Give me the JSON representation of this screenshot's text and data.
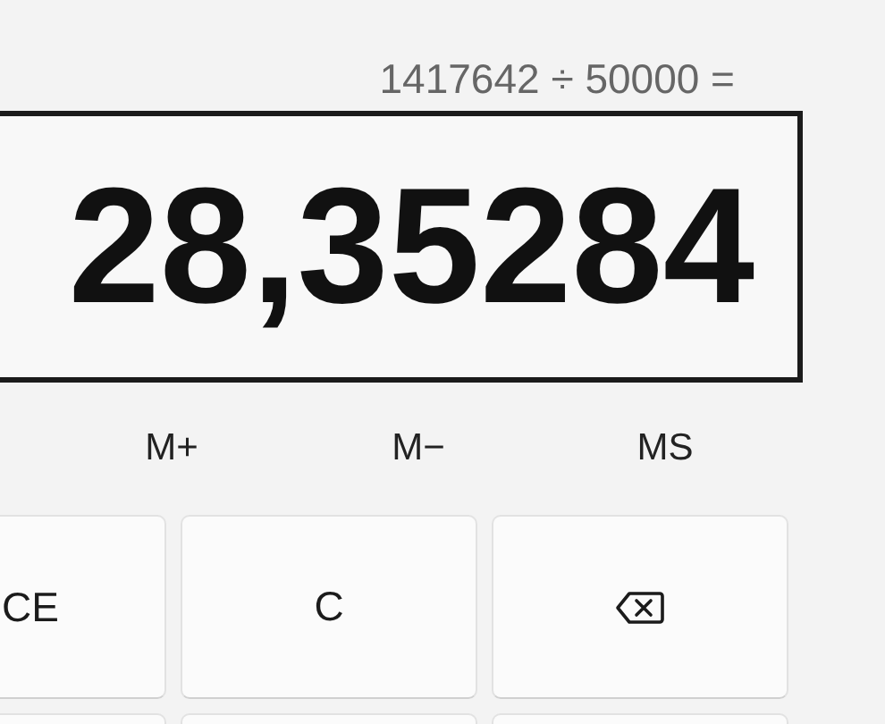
{
  "expression": "1417642 ÷ 50000 =",
  "display": "28,35284",
  "memory_buttons": [
    "M+",
    "M−",
    "MS"
  ],
  "keys": [
    {
      "kind": "text",
      "label": "CE"
    },
    {
      "kind": "text",
      "label": "C"
    },
    {
      "kind": "backspace"
    }
  ]
}
